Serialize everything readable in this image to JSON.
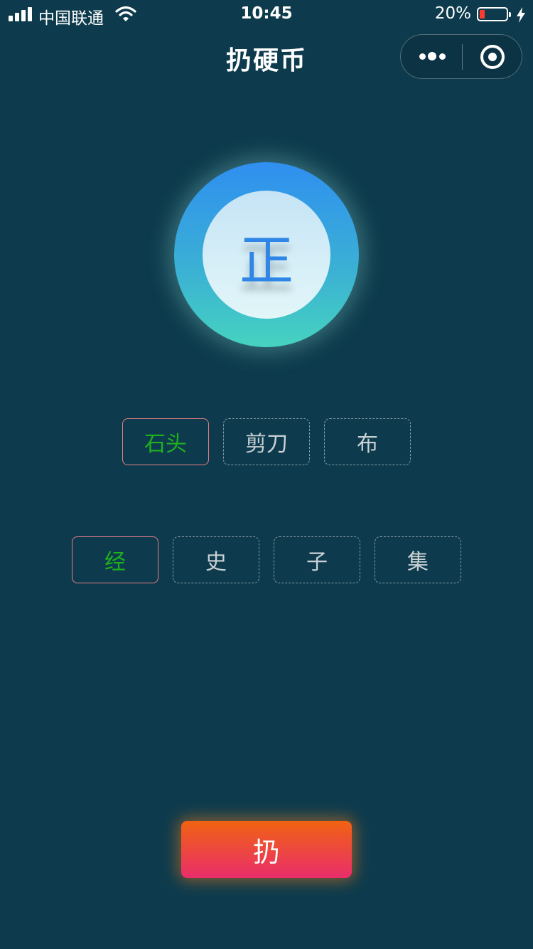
{
  "status_bar": {
    "carrier": "中国联通",
    "time": "10:45",
    "battery_percent": "20%",
    "battery_level": 0.2,
    "battery_color": "#ff3b30"
  },
  "nav": {
    "title": "扔硬币",
    "menu_icon": "more-dots-icon",
    "close_icon": "target-close-icon"
  },
  "coin": {
    "face": "正"
  },
  "options": {
    "row1": [
      {
        "label": "石头",
        "selected": true
      },
      {
        "label": "剪刀",
        "selected": false
      },
      {
        "label": "布",
        "selected": false
      }
    ],
    "row2": [
      {
        "label": "经",
        "selected": true
      },
      {
        "label": "史",
        "selected": false
      },
      {
        "label": "子",
        "selected": false
      },
      {
        "label": "集",
        "selected": false
      }
    ]
  },
  "action": {
    "throw_label": "扔"
  },
  "colors": {
    "background": "#0d3b4d",
    "selected_text": "#1fb01e",
    "selected_border": "#e47f84",
    "button_top": "#f06312",
    "button_bottom": "#ea2d6a",
    "coin_face": "#2f86e6"
  }
}
